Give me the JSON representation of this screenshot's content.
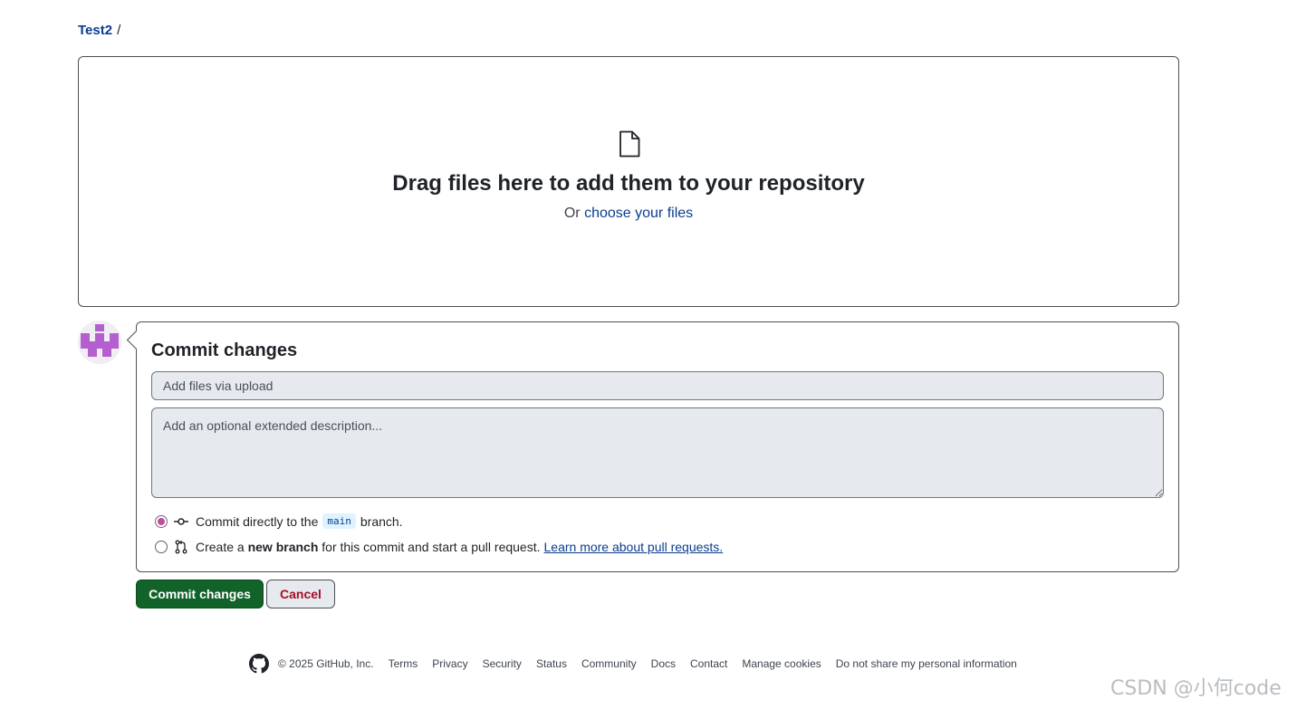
{
  "breadcrumb": {
    "repo": "Test2",
    "separator": "/"
  },
  "dropzone": {
    "icon": "file-icon",
    "title": "Drag files here to add them to your repository",
    "prefix": "Or",
    "link": "choose your files"
  },
  "avatar": {
    "icon": "identicon",
    "color": "#b35fd0"
  },
  "commit": {
    "heading": "Commit changes",
    "summary_placeholder": "Add files via upload",
    "description_placeholder": "Add an optional extended description...",
    "option_direct": {
      "selected": true,
      "icon": "git-commit-icon",
      "text_before": "Commit directly to the",
      "branch": "main",
      "text_after": "branch."
    },
    "option_new_branch": {
      "selected": false,
      "icon": "git-pull-request-icon",
      "text_before": "Create a",
      "bold": "new branch",
      "text_after": "for this commit and start a pull request.",
      "link": "Learn more about pull requests."
    }
  },
  "buttons": {
    "commit": "Commit changes",
    "cancel": "Cancel"
  },
  "footer": {
    "icon": "github-mark-icon",
    "copyright": "© 2025 GitHub, Inc.",
    "links": [
      "Terms",
      "Privacy",
      "Security",
      "Status",
      "Community",
      "Docs",
      "Contact",
      "Manage cookies",
      "Do not share my personal information"
    ]
  },
  "watermark": "CSDN @小何code",
  "colors": {
    "primary_button": "#116329",
    "cancel_text": "#a40e26",
    "link": "#0a3d8f",
    "input_bg": "#e6e9ed"
  }
}
